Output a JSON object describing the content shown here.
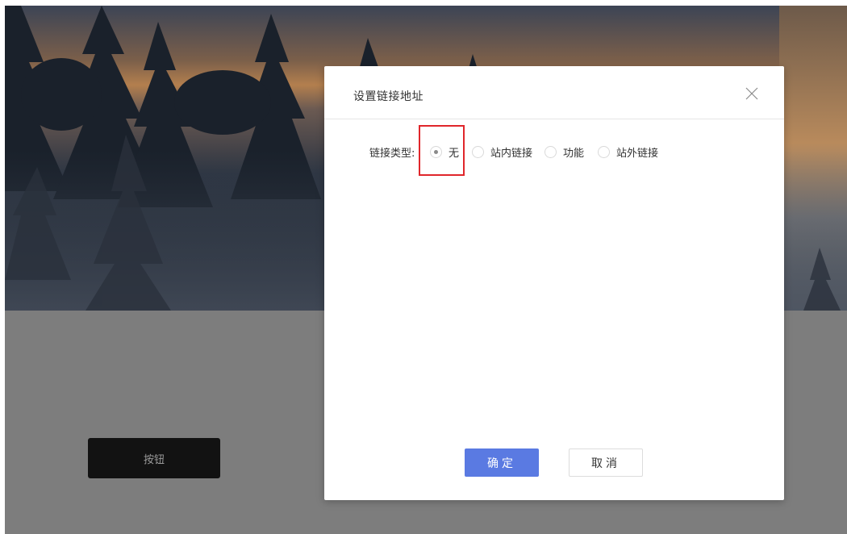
{
  "page": {
    "button_label": "按钮"
  },
  "dialog": {
    "title": "设置链接地址",
    "close_icon": "close-icon",
    "field_label": "链接类型:",
    "options": [
      {
        "label": "无",
        "checked": true
      },
      {
        "label": "站内链接",
        "checked": false
      },
      {
        "label": "功能",
        "checked": false
      },
      {
        "label": "站外链接",
        "checked": false
      }
    ],
    "ok_label": "确定",
    "cancel_label": "取消"
  },
  "colors": {
    "primary": "#5a7ae2",
    "highlight": "#e0262b",
    "overlay_gray": "#7d7d7d",
    "page_button_bg": "#121212"
  }
}
